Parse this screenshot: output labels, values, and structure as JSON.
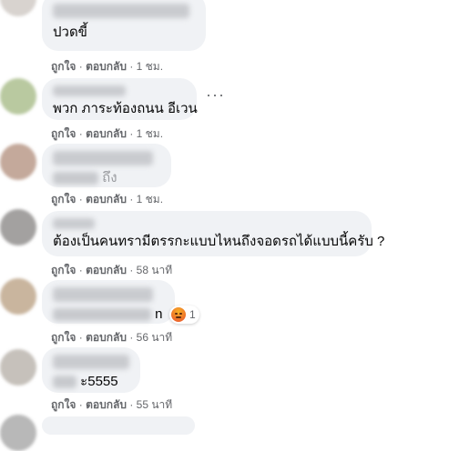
{
  "comments": [
    {
      "text": "ปวดขี้",
      "like": "ถูกใจ",
      "reply": "ตอบกลับ",
      "time": "1 ชม."
    },
    {
      "text": "พวก ภาระท้องถนน อีเวน",
      "like": "ถูกใจ",
      "reply": "ตอบกลับ",
      "time": "1 ชม."
    },
    {
      "text": "ถึง",
      "like": "ถูกใจ",
      "reply": "ตอบกลับ",
      "time": "1 ชม."
    },
    {
      "text": "ต้องเป็นคนทรามีตรรกะแบบไหนถึงจอดรถได้แบบนี้ครับ ?",
      "like": "ถูกใจ",
      "reply": "ตอบกลับ",
      "time": "58 นาที"
    },
    {
      "text": "n",
      "reaction_count": "1",
      "like": "ถูกใจ",
      "reply": "ตอบกลับ",
      "time": "56 นาที"
    },
    {
      "text": "ะ5555",
      "like": "ถูกใจ",
      "reply": "ตอบกลับ",
      "time": "55 นาที"
    }
  ],
  "separator": "·",
  "more_label": "···",
  "colors": {
    "bubble": "#f0f2f5",
    "meta": "#65676b",
    "text": "#050505"
  }
}
